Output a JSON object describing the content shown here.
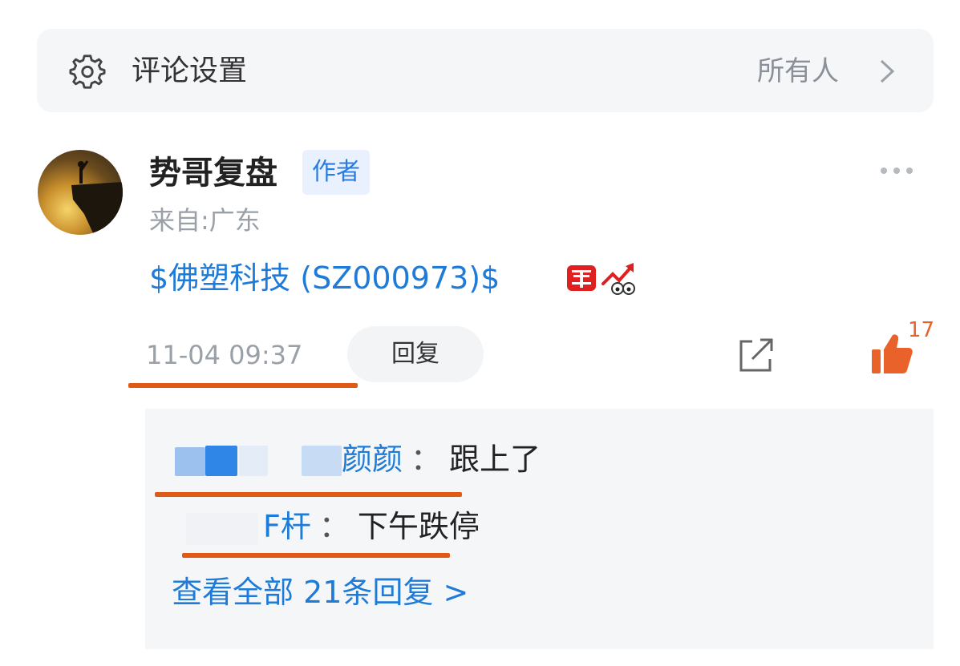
{
  "settings": {
    "title": "评论设置",
    "value": "所有人",
    "icon": "gear-icon"
  },
  "comment": {
    "author": "势哥复盘",
    "badge": "作者",
    "origin": "来自:广东",
    "stock_text": "$佛塑科技 (SZ000973)$",
    "timestamp": "11-04 09:37",
    "reply_label": "回复",
    "like_count": "17"
  },
  "replies": [
    {
      "name": "颜颜",
      "sep": "：",
      "text": "跟上了"
    },
    {
      "name": "F杆",
      "sep": "：",
      "text": "下午跌停"
    }
  ],
  "view_all": "查看全部 21条回复 >",
  "colors": {
    "link_blue": "#1f7bd8",
    "underline_orange": "#e05a16",
    "like_orange": "#e8622a",
    "panel_bg": "#f5f6f8"
  }
}
